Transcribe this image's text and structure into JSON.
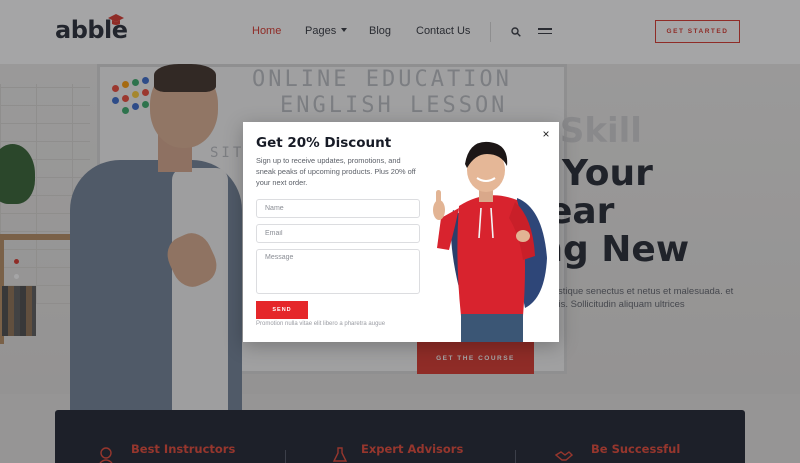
{
  "header": {
    "logo": "abble",
    "nav": [
      {
        "label": "Home",
        "active": true
      },
      {
        "label": "Pages",
        "has_dropdown": true
      },
      {
        "label": "Blog"
      },
      {
        "label": "Contact Us"
      }
    ],
    "search_icon": "search-icon",
    "menu_icon": "hamburger-icon",
    "cta": "GET STARTED"
  },
  "hero": {
    "whiteboard_line1": "ONLINE EDUCATION",
    "whiteboard_line2": "ENGLISH LESSON",
    "whiteboard_side": "SIT",
    "title_line0": "e Skill",
    "title_line1": "e Your",
    "title_line2": "Lear",
    "title_line3": "ing New",
    "description": "bi tristique senectus et netus et malesuada. et mattis. Sollicitudin aliquam ultrices",
    "button": "GET THE COURSE"
  },
  "features": [
    {
      "label": "Best Instructors",
      "icon": "instructor-icon"
    },
    {
      "label": "Expert Advisors",
      "icon": "advisor-icon"
    },
    {
      "label": "Be Successful",
      "icon": "handshake-icon"
    }
  ],
  "modal": {
    "title": "Get 20% Discount",
    "text": "Sign up to receive updates, promotions, and sneak peaks of upcoming products. Plus 20% off your next order.",
    "name_placeholder": "Name",
    "email_placeholder": "Email",
    "message_placeholder": "Message",
    "send": "SEND",
    "note": "Promotion nulla vitae elit libero a pharetra augue",
    "close": "×"
  },
  "colors": {
    "accent": "#d93025",
    "dark": "#161b29",
    "text": "#1b1f2a"
  }
}
